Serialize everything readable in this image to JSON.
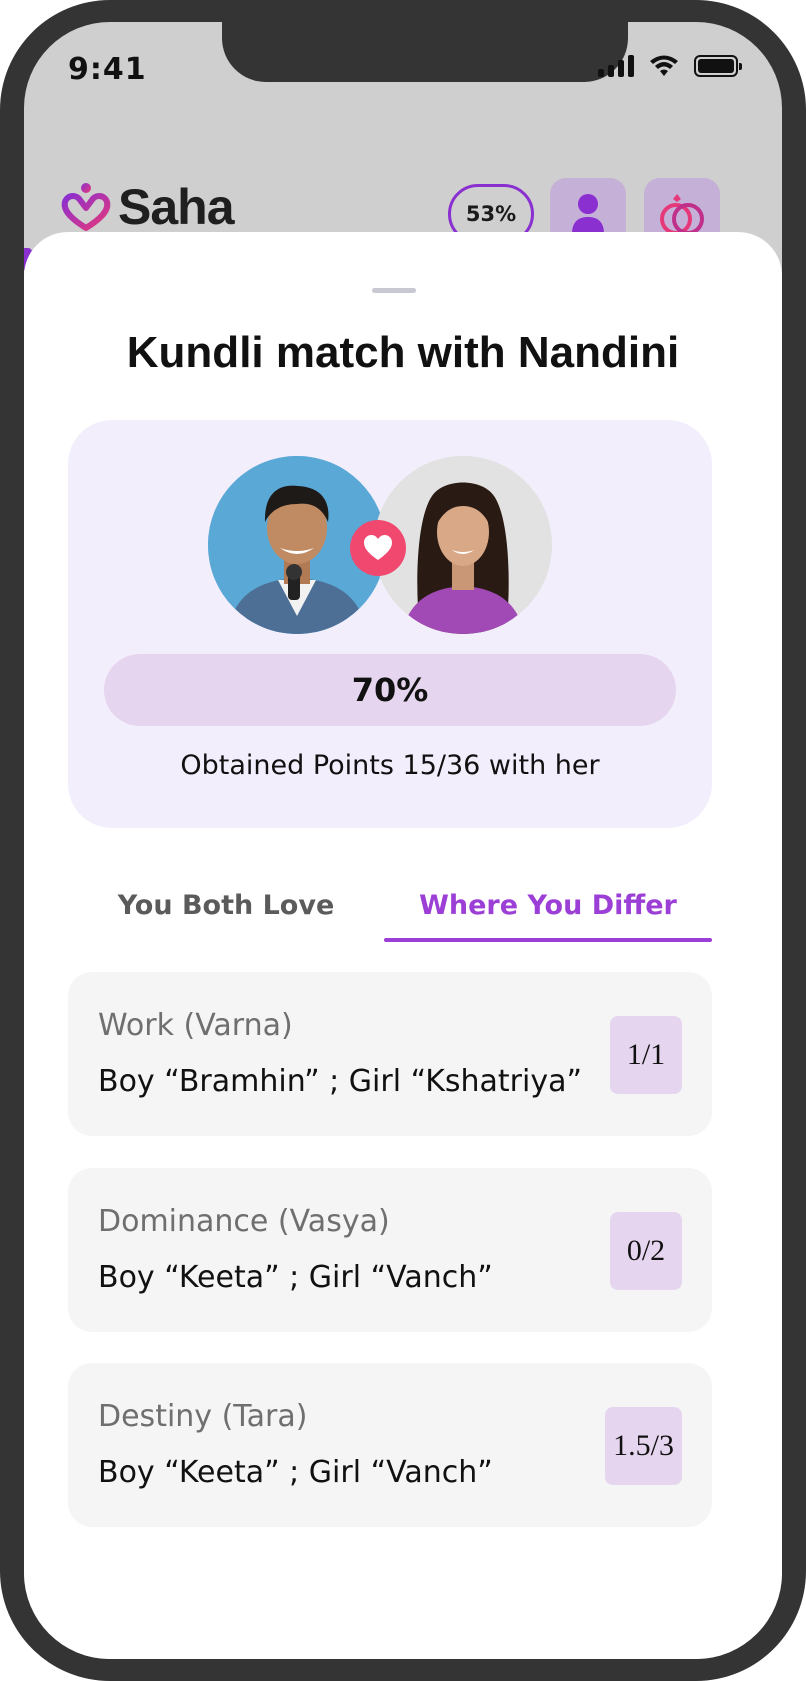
{
  "status_bar": {
    "time": "9:41"
  },
  "header": {
    "brand": "Saha",
    "match_percent": "53%"
  },
  "sheet": {
    "title": "Kundli match with Nandini",
    "score": "70%",
    "score_value": 0.7,
    "points_text": "Obtained Points 15/36 with her"
  },
  "tabs": [
    {
      "label": "You Both Love",
      "active": false
    },
    {
      "label": "Where You Differ",
      "active": true
    }
  ],
  "items": [
    {
      "title": "Work (Varna)",
      "detail": "Boy “Bramhin” ; Girl “Kshatriya”",
      "score": "1/1"
    },
    {
      "title": "Dominance (Vasya)",
      "detail": "Boy “Keeta” ; Girl “Vanch”",
      "score": "0/2"
    },
    {
      "title": "Destiny (Tara)",
      "detail": "Boy “Keeta” ; Girl “Vanch”",
      "score": "1.5/3"
    }
  ],
  "colors": {
    "accent": "#9b3fd6",
    "card_bg": "#f3eefc",
    "score_bar": "#e5d5ee",
    "heart": "#f0486e",
    "item_bg": "#f5f5f5"
  },
  "icons": {
    "logo": "saha-heart-logo-icon",
    "profile": "person-icon",
    "rings": "rings-icon",
    "heart": "heart-icon"
  }
}
